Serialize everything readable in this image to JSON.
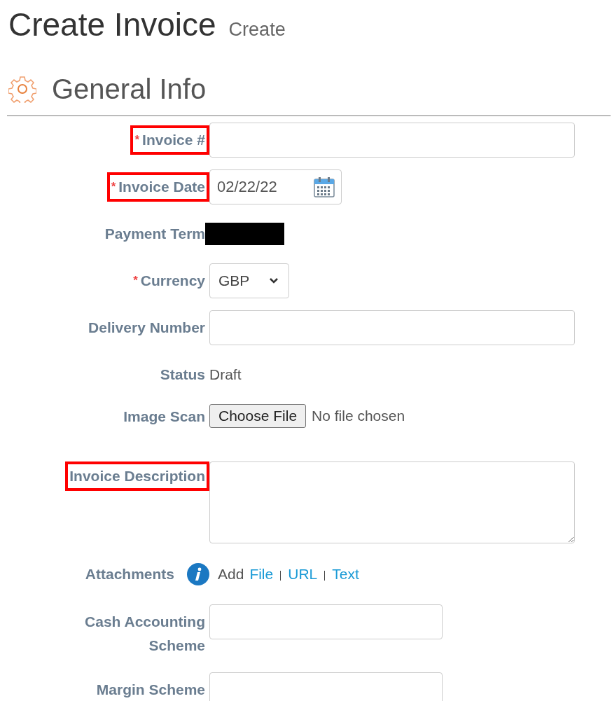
{
  "page": {
    "title": "Create Invoice",
    "subtitle": "Create"
  },
  "section": {
    "title": "General Info"
  },
  "fields": [
    {
      "kind": "text",
      "label": "Invoice #",
      "required_mark": "*",
      "highlighted": true
    },
    {
      "kind": "date",
      "label": "Invoice Date",
      "required_mark": "*",
      "highlighted": true,
      "value": "02/22/22"
    },
    {
      "kind": "redacted",
      "label": "Payment Term",
      "highlighted": false
    },
    {
      "kind": "select",
      "label": "Currency",
      "required_mark": "*",
      "highlighted": false,
      "value": "GBP"
    },
    {
      "kind": "text",
      "label": "Delivery Number",
      "highlighted": false
    },
    {
      "kind": "static",
      "label": "Status",
      "highlighted": false,
      "value": "Draft"
    },
    {
      "kind": "file",
      "label": "Image Scan",
      "highlighted": false,
      "button": "Choose File",
      "status": "No file chosen"
    },
    {
      "kind": "textarea",
      "label": "Invoice Description",
      "highlighted": true
    },
    {
      "kind": "attachments",
      "label": "Attachments",
      "highlighted": false,
      "prefix": "Add",
      "links": [
        "File",
        "URL",
        "Text"
      ]
    },
    {
      "kind": "short",
      "label": "Cash Accounting Scheme",
      "highlighted": false
    },
    {
      "kind": "short",
      "label": "Margin Scheme",
      "highlighted": false
    }
  ]
}
